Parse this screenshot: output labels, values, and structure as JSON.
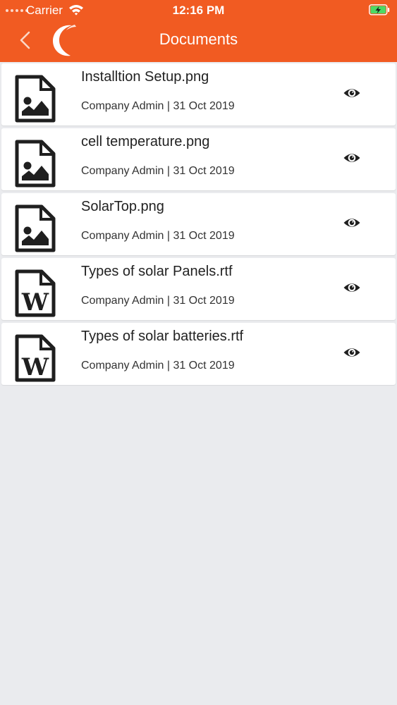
{
  "status_bar": {
    "carrier": "Carrier",
    "time": "12:16 PM",
    "battery_color": "#4cd964"
  },
  "header": {
    "title": "Documents",
    "background_color": "#f15b22",
    "back_icon": "chevron-left-icon",
    "logo": "crescent-logo"
  },
  "documents": [
    {
      "name": "Installtion Setup.png",
      "meta": "Company Admin | 31 Oct 2019",
      "icon": "image-file-icon",
      "action_icon": "eye-icon"
    },
    {
      "name": "cell temperature.png",
      "meta": "Company Admin | 31 Oct 2019",
      "icon": "image-file-icon",
      "action_icon": "eye-icon"
    },
    {
      "name": "SolarTop.png",
      "meta": "Company Admin | 31 Oct 2019",
      "icon": "image-file-icon",
      "action_icon": "eye-icon"
    },
    {
      "name": "Types of solar Panels.rtf",
      "meta": "Company Admin | 31 Oct 2019",
      "icon": "word-file-icon",
      "action_icon": "eye-icon"
    },
    {
      "name": "Types of solar batteries.rtf",
      "meta": "Company Admin | 31 Oct 2019",
      "icon": "word-file-icon",
      "action_icon": "eye-icon"
    }
  ]
}
